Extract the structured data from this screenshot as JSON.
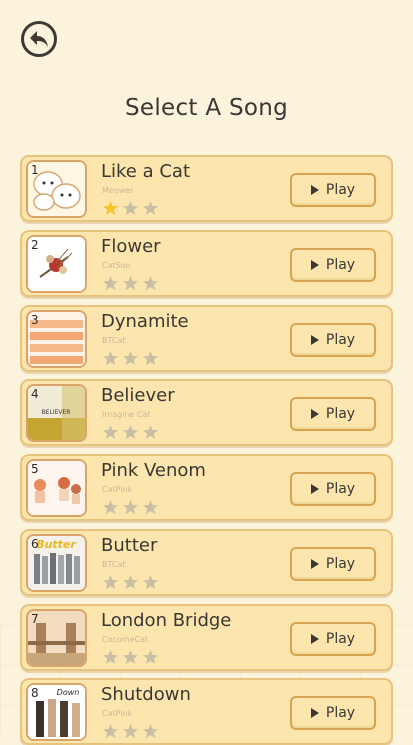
{
  "header": {
    "title": "Select A Song"
  },
  "songs": [
    {
      "num": "1",
      "name": "Like a Cat",
      "artist": "Meower",
      "stars": 1,
      "play": "Play",
      "art": "cat"
    },
    {
      "num": "2",
      "name": "Flower",
      "artist": "CatSoo",
      "stars": 0,
      "play": "Play",
      "art": "flower"
    },
    {
      "num": "3",
      "name": "Dynamite",
      "artist": "BTCat",
      "stars": 0,
      "play": "Play",
      "art": "dynamite"
    },
    {
      "num": "4",
      "name": "Believer",
      "artist": "Imagine Cat",
      "stars": 0,
      "play": "Play",
      "art": "believer",
      "art_text": "BELIEVER"
    },
    {
      "num": "5",
      "name": "Pink Venom",
      "artist": "CatPink",
      "stars": 0,
      "play": "Play",
      "art": "pink"
    },
    {
      "num": "6",
      "name": "Butter",
      "artist": "BTCat",
      "stars": 0,
      "play": "Play",
      "art": "butter",
      "art_text": "Butter"
    },
    {
      "num": "7",
      "name": "London Bridge",
      "artist": "CocomeCat",
      "stars": 0,
      "play": "Play",
      "art": "bridge"
    },
    {
      "num": "8",
      "name": "Shutdown",
      "artist": "CatPink",
      "stars": 0,
      "play": "Play",
      "art": "shutdown",
      "art_text": "Down"
    }
  ],
  "colors": {
    "star_filled": "#f4c62e",
    "star_empty": "#c9bfa6",
    "card_bg": "#fde6ad"
  },
  "icons": {
    "back": "back-arrow-icon",
    "play": "play-icon",
    "star": "star-icon"
  }
}
